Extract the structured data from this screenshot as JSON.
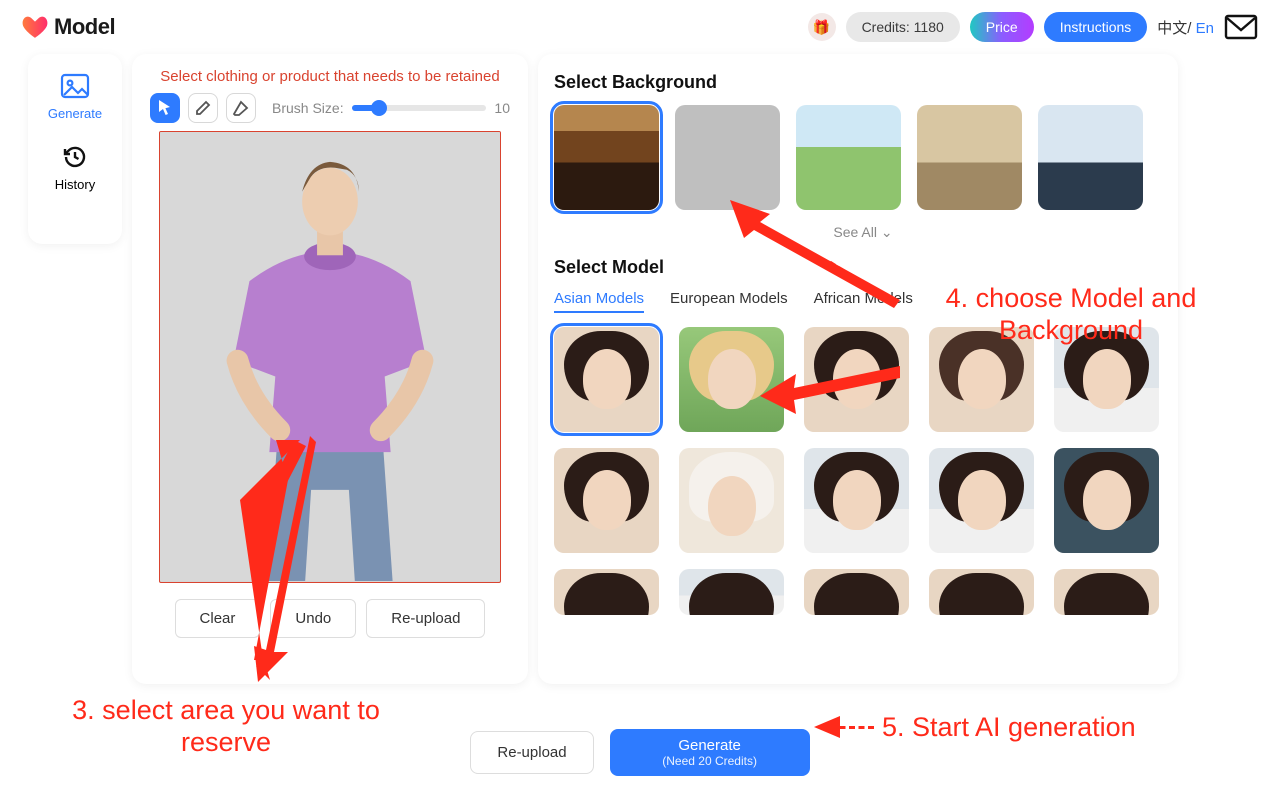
{
  "brand": {
    "name": "Model"
  },
  "top": {
    "credits": "Credits: 1180",
    "price": "Price",
    "instructions": "Instructions",
    "lang_zh": "中文/",
    "lang_en": "En"
  },
  "nav": {
    "generate": "Generate",
    "history": "History"
  },
  "editor": {
    "hint": "Select clothing or product that needs to be retained",
    "brush_label": "Brush Size:",
    "brush_value": "10",
    "clear": "Clear",
    "undo": "Undo",
    "reupload": "Re-upload"
  },
  "right": {
    "select_bg": "Select Background",
    "see_all": "See All",
    "select_model": "Select Model",
    "tabs": {
      "asian": "Asian Models",
      "european": "European Models",
      "african": "African Models"
    }
  },
  "footer": {
    "reupload": "Re-upload",
    "generate": "Generate",
    "need": "(Need 20 Credits)"
  },
  "annotations": {
    "step3": "3. select area you want to reserve",
    "step4": "4. choose Model and Background",
    "step5": "5. Start AI generation"
  }
}
